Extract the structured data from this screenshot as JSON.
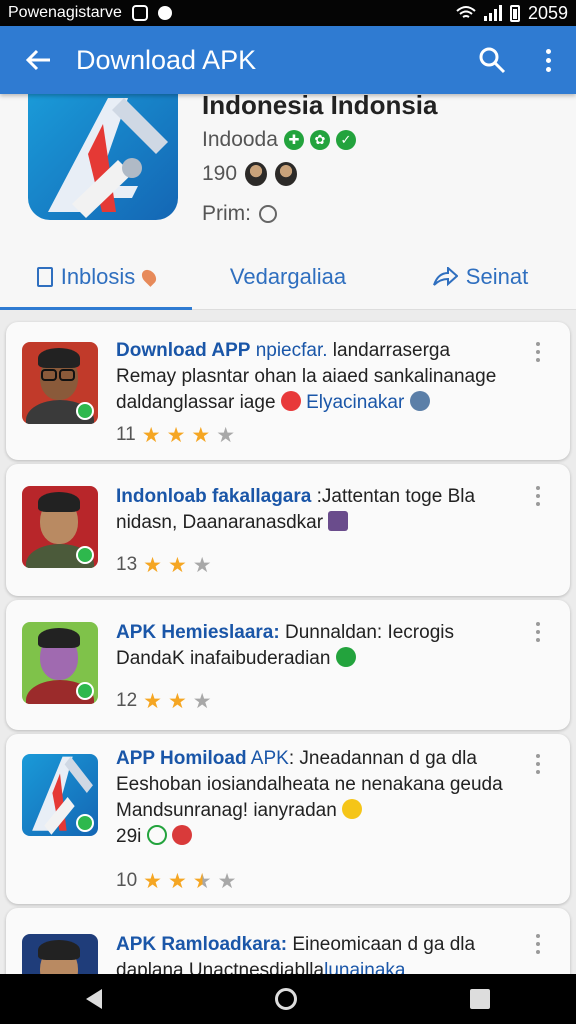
{
  "status_bar": {
    "left_text": "Powenagistarve",
    "time": "2059"
  },
  "app_bar": {
    "title": "Download APK",
    "icons": [
      "back-arrow-icon",
      "search-icon",
      "more-vert-icon"
    ]
  },
  "app": {
    "title": "Indonesia Indonsia",
    "developer": "Indooda",
    "count": "190",
    "price_label": "Prim:",
    "icon_colors": [
      "#1a9ad8",
      "#1466b4",
      "#e53935"
    ]
  },
  "tabs": [
    {
      "label": "Inblosis",
      "active": true
    },
    {
      "label": "Vedargaliaa",
      "active": false
    },
    {
      "label": "Seinat",
      "active": false
    }
  ],
  "reviews": [
    {
      "title": "Download APP",
      "title_rest": "npiecfar.",
      "lines": [
        " landarraserga",
        "Remay plasntar ohan la aiaed sankalinanage",
        "daldanglassar iage"
      ],
      "link": "Elyacinakar",
      "count": "11",
      "rating": 3
    },
    {
      "title": "Indonloab fakallagara",
      "lines": [
        ":Jattentan toge Bla",
        "nidasn, Daanaranasdkar"
      ],
      "count": "13",
      "rating": 2
    },
    {
      "title": "APK Hemieslaara:",
      "lines": [
        " Dunnaldan: Iecrogis",
        "DandaK inafaibuderadian"
      ],
      "count": "12",
      "rating": 2
    },
    {
      "title": "APP Homiload",
      "title_rest": "APK",
      "lines": [
        ": Jneadannan d ga dla",
        "Eeshoban iosiandalheata ne nenakana geuda",
        "Mandsunranag! ianyradan"
      ],
      "extra": "29i",
      "count": "10",
      "rating": 2.5
    },
    {
      "title": "APK Ramloadkara:",
      "lines": [
        " Eineomicaan d ga dla",
        "daplana Unactnesdiablla",
        "lunainaka"
      ]
    }
  ]
}
